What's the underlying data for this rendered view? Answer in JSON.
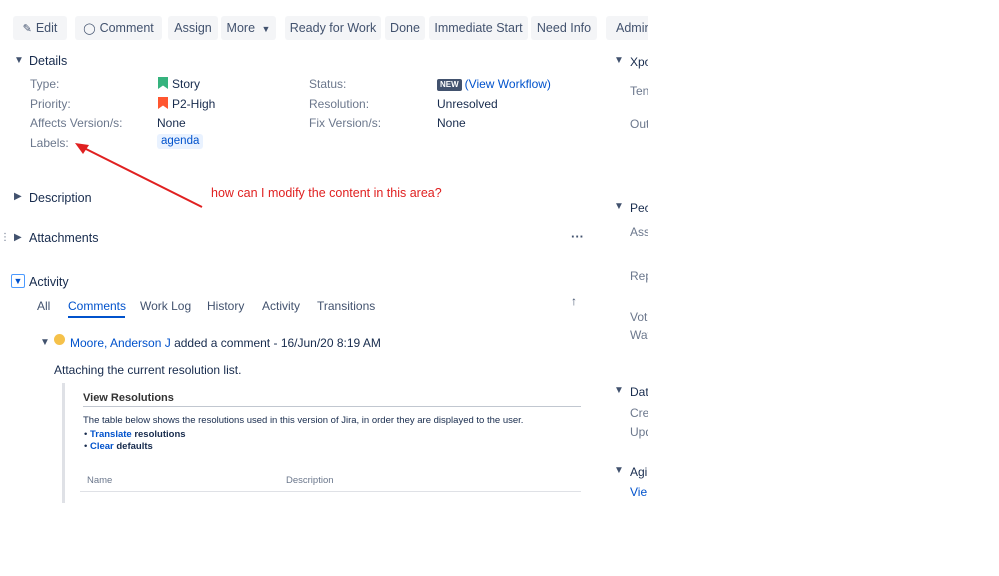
{
  "toolbar": {
    "edit": "Edit",
    "comment": "Comment",
    "assign": "Assign",
    "more": "More",
    "ready_for_work": "Ready for Work",
    "done": "Done",
    "immediate_start": "Immediate Start",
    "need_info": "Need Info",
    "admin": "Admin"
  },
  "details": {
    "title": "Details",
    "type_label": "Type:",
    "type_value": "Story",
    "priority_label": "Priority:",
    "priority_value": "P2-High",
    "affects_label": "Affects Version/s:",
    "affects_value": "None",
    "labels_label": "Labels:",
    "labels_value": "agenda",
    "status_label": "Status:",
    "status_badge": "NEW",
    "status_link": "(View Workflow)",
    "resolution_label": "Resolution:",
    "resolution_value": "Unresolved",
    "fix_label": "Fix Version/s:",
    "fix_value": "None"
  },
  "annotation": {
    "text": "how can I modify the content in this area?",
    "color": "#e02020"
  },
  "description": {
    "title": "Description"
  },
  "attachments": {
    "title": "Attachments",
    "more": "···"
  },
  "activity": {
    "title": "Activity",
    "tabs": [
      "All",
      "Comments",
      "Work Log",
      "History",
      "Activity",
      "Transitions"
    ],
    "active_tab": "Comments",
    "sort_icon": "↑"
  },
  "comment": {
    "author": "Moore, Anderson J",
    "action": "added a comment -",
    "timestamp": "16/Jun/20 8:19 AM",
    "body": "Attaching the current resolution list.",
    "embed": {
      "title": "View Resolutions",
      "intro": "The table below shows the resolutions used in this version of Jira, in order they are displayed to the user.",
      "bullet1_link": "Translate",
      "bullet1_rest": "resolutions",
      "bullet2_link": "Clear",
      "bullet2_rest": "defaults",
      "col_name": "Name",
      "col_desc": "Description"
    }
  },
  "right_panel": {
    "xpo": "Xpo",
    "ten": "Ten",
    "out": "Out",
    "pec": "Pec",
    "ass": "Ass",
    "rep": "Rep",
    "vot": "Vot",
    "wat": "Wat",
    "dat": "Dat",
    "cre": "Cre",
    "upd": "Upd",
    "agi": "Agi",
    "view": "Vie"
  },
  "colors": {
    "link": "#0052cc",
    "story_icon": "#36b37e",
    "priority_icon": "#ff5630",
    "arrow": "#e02020"
  }
}
